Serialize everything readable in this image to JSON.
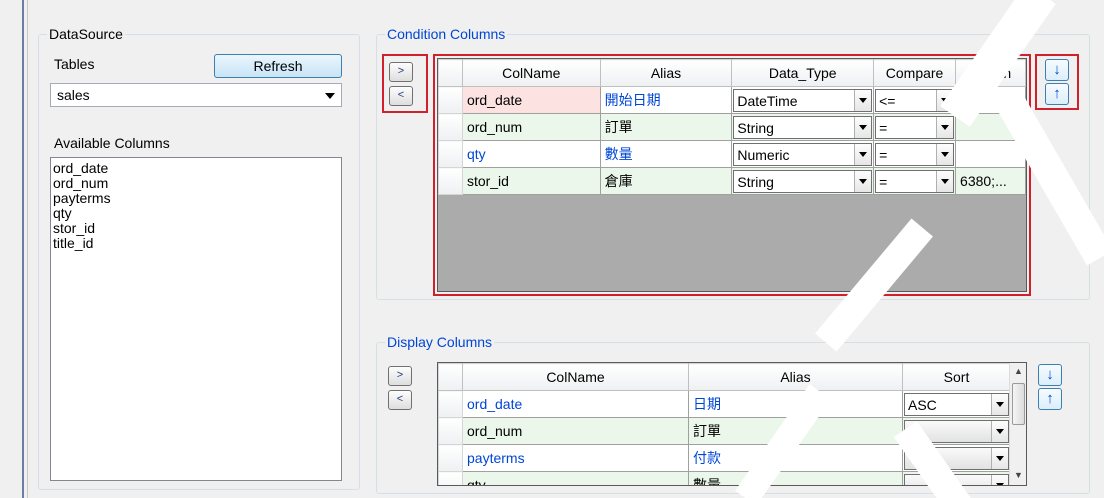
{
  "datasource": {
    "legend": "DataSource",
    "tables_label": "Tables",
    "refresh_label": "Refresh",
    "table_selected": "sales",
    "available_label": "Available Columns",
    "available_columns": [
      "ord_date",
      "ord_num",
      "payterms",
      "qty",
      "stor_id",
      "title_id"
    ]
  },
  "condition": {
    "legend": "Condition Columns",
    "add_label": ">",
    "remove_label": "<",
    "down_label": "↓",
    "up_label": "↑",
    "headers": [
      "ColName",
      "Alias",
      "Data_Type",
      "Compare",
      "Option"
    ],
    "rows": [
      {
        "colname": "ord_date",
        "alias": "開始日期",
        "data_type": "DateTime",
        "compare": "<=",
        "option": ""
      },
      {
        "colname": "ord_num",
        "alias": "訂單",
        "data_type": "String",
        "compare": "=",
        "option": ""
      },
      {
        "colname": "qty",
        "alias": "數量",
        "data_type": "Numeric",
        "compare": "=",
        "option": ""
      },
      {
        "colname": "stor_id",
        "alias": "倉庫",
        "data_type": "String",
        "compare": "=",
        "option": "6380;..."
      }
    ]
  },
  "display": {
    "legend": "Display Columns",
    "add_label": ">",
    "remove_label": "<",
    "down_label": "↓",
    "up_label": "↑",
    "headers": [
      "ColName",
      "Alias",
      "Sort"
    ],
    "rows": [
      {
        "colname": "ord_date",
        "alias": "日期",
        "sort": "ASC"
      },
      {
        "colname": "ord_num",
        "alias": "訂單",
        "sort": ""
      },
      {
        "colname": "payterms",
        "alias": "付款",
        "sort": ""
      },
      {
        "colname": "qty",
        "alias": "數量",
        "sort": ""
      }
    ]
  },
  "colors": {
    "accent": "#0046d5",
    "highlight": "#d0202b"
  }
}
